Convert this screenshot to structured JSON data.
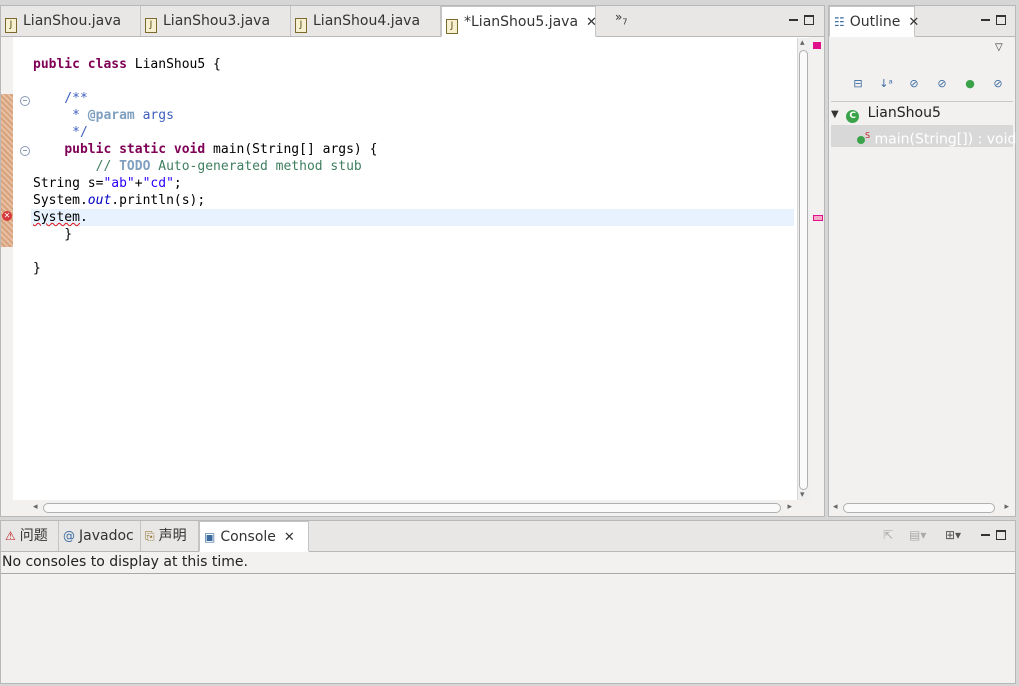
{
  "editor": {
    "tabs": [
      {
        "label": "LianShou.java"
      },
      {
        "label": "LianShou3.java"
      },
      {
        "label": "LianShou4.java"
      },
      {
        "label": "*LianShou5.java",
        "active": true
      }
    ],
    "overflow_label": "»",
    "overflow_count": "7",
    "code": {
      "l1": {
        "kw1": "public",
        "kw2": "class",
        "rest": " LianShou5 {"
      },
      "l2": {
        "text": "    /**"
      },
      "l3": {
        "pre": "     * ",
        "tag": "@param",
        "rest": " args"
      },
      "l4": {
        "text": "     */"
      },
      "l5": {
        "indent": "    ",
        "kw1": "public",
        "kw2": "static",
        "kw3": "void",
        "rest": " main(String[] args) {"
      },
      "l6": {
        "indent": "        ",
        "pre": "// ",
        "todo": "TODO",
        "rest": " Auto-generated method stub"
      },
      "l7": {
        "pre": "String s=",
        "s1": "\"ab\"",
        "mid": "+",
        "s2": "\"cd\"",
        "end": ";"
      },
      "l8": {
        "pre": "System.",
        "it": "out",
        "rest": ".println(s);"
      },
      "l9": {
        "err": "System",
        "rest": "."
      },
      "l10": {
        "text": "    }"
      },
      "l11": {
        "text": "}"
      }
    }
  },
  "outline": {
    "title": "Outline",
    "class_name": "LianShou5",
    "method": "main(String[]) : void",
    "static_marker": "S"
  },
  "bottom": {
    "tabs": [
      {
        "label": "问题"
      },
      {
        "label": "Javadoc"
      },
      {
        "label": "声明"
      },
      {
        "label": "Console",
        "active": true
      }
    ],
    "message": "No consoles to display at this time."
  },
  "icons": {
    "error": "error-icon",
    "class": "class-icon",
    "method": "method-icon"
  },
  "colors": {
    "keyword": "#7f0055",
    "comment": "#3f5fbf",
    "string": "#2a00ff",
    "error": "#d63a3a"
  }
}
